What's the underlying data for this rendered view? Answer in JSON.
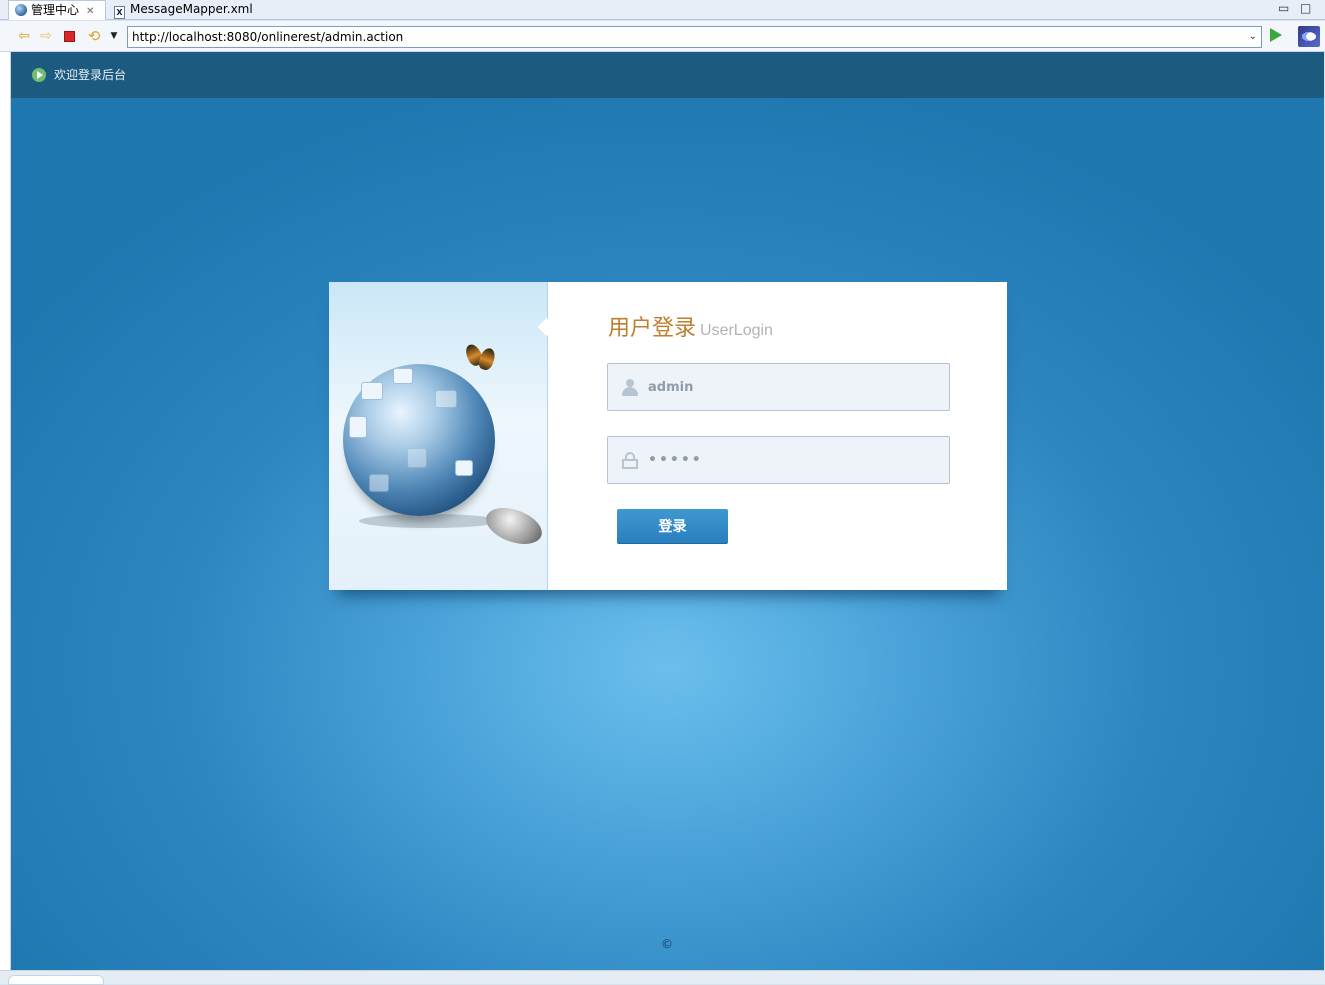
{
  "tabs": [
    {
      "label": "管理中心",
      "active": true,
      "icon": "globe-icon"
    },
    {
      "label": "MessageMapper.xml",
      "active": false,
      "icon": "xml-file-icon"
    }
  ],
  "window_controls": {
    "minimize": "▭",
    "maximize": "□"
  },
  "address_bar": {
    "url": "http://localhost:8080/onlinerest/admin.action"
  },
  "page": {
    "header": {
      "welcome": "欢迎登录后台"
    },
    "login": {
      "title_cn": "用户登录",
      "title_en": "UserLogin",
      "username_value": "admin",
      "password_value": "•••••",
      "submit_label": "登录"
    },
    "footer": {
      "copyright": "©"
    }
  },
  "colors": {
    "header_band": "#1d5a80",
    "background_blue": "#2d86c0",
    "title_accent": "#c07f2f",
    "button_blue": "#2a7fbe"
  }
}
